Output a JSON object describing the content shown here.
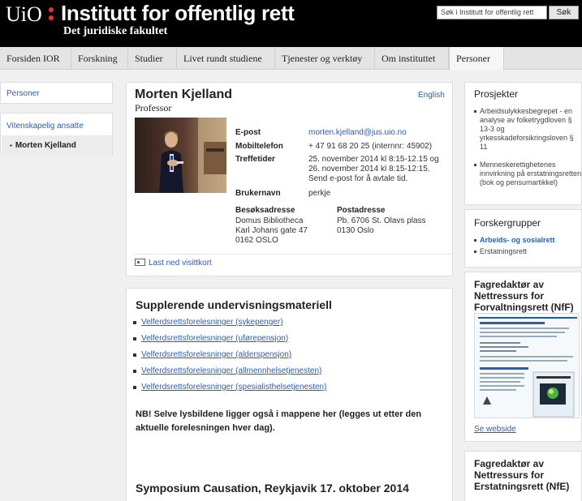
{
  "header": {
    "logo": "UiO",
    "title": "Institutt for offentlig rett",
    "subtitle": "Det juridiske fakultet",
    "search_placeholder": "Søk i Institutt for offentlig rett",
    "search_button": "Søk"
  },
  "nav": {
    "tabs": [
      "Forsiden IOR",
      "Forskning",
      "Studier",
      "Livet rundt studiene",
      "Tjenester og verktøy",
      "Om instituttet",
      "Personer"
    ],
    "active": "Personer"
  },
  "left": {
    "personer": "Personer",
    "group": "Vitenskapelig ansatte",
    "selected": "Morten Kjelland"
  },
  "profile": {
    "name": "Morten Kjelland",
    "title": "Professor",
    "language_link": "English",
    "email_label": "E-post",
    "email": "morten.kjelland@jus.uio.no",
    "mobile_label": "Mobiltelefon",
    "mobile": "+ 47 91 68 20 25 (internnr: 45902)",
    "hours_label": "Treffetider",
    "hours_line1": "25. november 2014 kl 8:15-12.15 og",
    "hours_line2": "26. november 2014 kl 8:15-12:15.",
    "hours_line3": "Send e-post for å avtale tid.",
    "username_label": "Brukernavn",
    "username": "perkje",
    "visit_label": "Besøksadresse",
    "visit_line1": "Domus Bibliotheca",
    "visit_line2": "Karl Johans gate 47",
    "visit_line3": "0162 OSLO",
    "postal_label": "Postadresse",
    "postal_line1": "Pb. 6706 St. Olavs plass",
    "postal_line2": "0130 Oslo",
    "vcard": "Last ned visittkort"
  },
  "material": {
    "title": "Supplerende undervisningsmateriell",
    "links": [
      "Velferdsrettsforelesninger (sykepenger)",
      "Velferdsrettsforelesninger (uførepensjon)",
      "Velferdsrettsforelesninger (alderspensjon)",
      "Velferdsrettsforelesninger (allmennhelsetjenesten)",
      "Velferdsrettsforelesninger (spesialisthelsetjenesten)"
    ],
    "note": "NB! Selve lysbildene ligger også i mappene her (legges ut etter den aktuelle forelesningen hver dag).",
    "symposium": "Symposium Causation, Reykjavik 17. oktober 2014"
  },
  "right": {
    "projects_title": "Prosjekter",
    "projects": [
      "Arbeidsulykkesbegrepet - en analyse av folketrygdloven § 13-3 og yrkesskadeforsikringsloven § 11",
      "Menneskerettighetenes innvirkning på erstatningsretten (bok og pensumartikkel)"
    ],
    "groups_title": "Forskergrupper",
    "groups": [
      "Arbeids- og sosialrett",
      "Erstatningsrett"
    ],
    "nff_title": "Fagredaktør av Nettressurs for Forvaltningsrett (NfF)",
    "nff_link": "Se webside",
    "nfe_title": "Fagredaktør av Nettressurs for Erstatningsrett (NfE)"
  }
}
